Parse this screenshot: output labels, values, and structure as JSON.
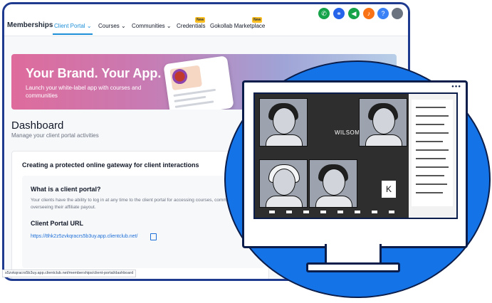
{
  "app": {
    "title": "Memberships"
  },
  "nav": {
    "tabs": [
      {
        "label": "Client Portal",
        "active": true,
        "dropdown": true
      },
      {
        "label": "Courses",
        "dropdown": true
      },
      {
        "label": "Communities",
        "dropdown": true
      },
      {
        "label": "Credentials",
        "badge": "New"
      },
      {
        "label": "Gokollab Marketplace",
        "badge": "New"
      }
    ]
  },
  "header_icons": [
    {
      "icon": "phone-icon",
      "color": "#16a34a"
    },
    {
      "icon": "link-icon",
      "color": "#2563eb"
    },
    {
      "icon": "megaphone-icon",
      "color": "#16a34a"
    },
    {
      "icon": "bell-icon",
      "color": "#f97316"
    },
    {
      "icon": "help-icon",
      "color": "#3b82f6",
      "glyph": "?"
    }
  ],
  "banner": {
    "title": "Your Brand. Your App.",
    "subtitle": "Launch your white-label app with courses and communities"
  },
  "dashboard": {
    "title": "Dashboard",
    "subtitle": "Manage your client portal activities"
  },
  "card": {
    "title": "Creating a protected online gateway for client interactions",
    "question": "What is a client portal?",
    "description": "Your clients have the ability to log in at any time to the client portal for accessing courses, communities, and overseeing their affiliate payout.",
    "url_title": "Client Portal URL",
    "url": "https://8hk2z5zvkqracrs5b3uy.app.clientclub.net/"
  },
  "status_bar": {
    "text": "s5zvkqracrs5b3uy.app.clientclub.net/memberships/client-portal/dashboard"
  },
  "illustration": {
    "name_label": "WILSOM",
    "k_label": "K"
  },
  "colors": {
    "accent": "#1d8fd8",
    "frame": "#1f3b8f",
    "blob": "#1473e6"
  }
}
